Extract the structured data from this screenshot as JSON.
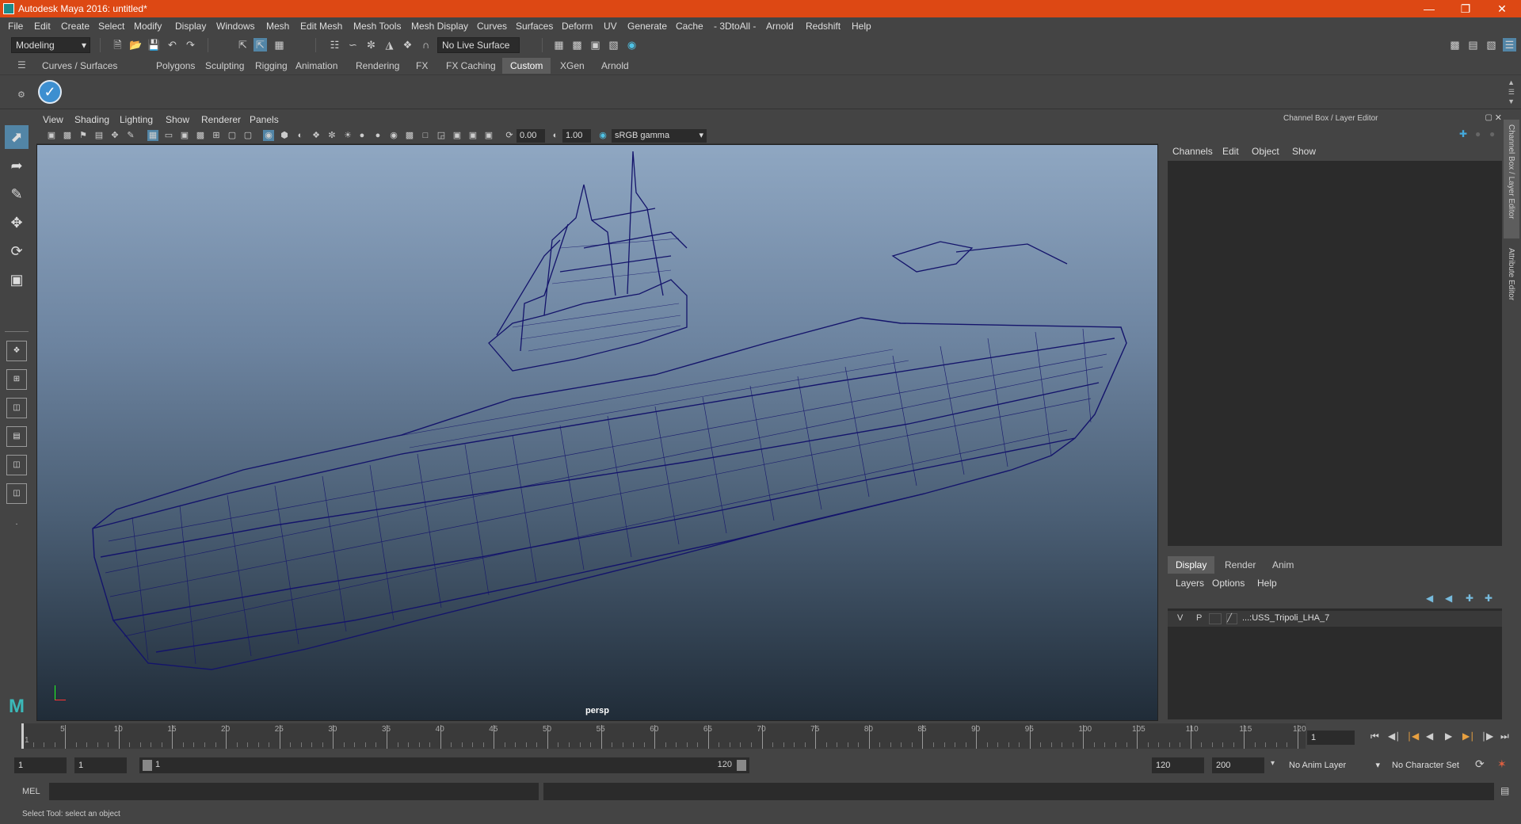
{
  "window": {
    "title": "Autodesk Maya 2016: untitled*",
    "minimize_icon": "minimize-icon",
    "restore_icon": "restore-icon",
    "close_icon": "close-icon"
  },
  "menubar": [
    "File",
    "Edit",
    "Create",
    "Select",
    "Modify",
    "Display",
    "Windows",
    "Mesh",
    "Edit Mesh",
    "Mesh Tools",
    "Mesh Display",
    "Curves",
    "Surfaces",
    "Deform",
    "UV",
    "Generate",
    "Cache",
    "- 3DtoAll -",
    "Arnold",
    "Redshift",
    "Help"
  ],
  "toolbar": {
    "mode": "Modeling",
    "live_surface": "No Live Surface"
  },
  "shelf_tabs": [
    "Curves / Surfaces",
    "Polygons",
    "Sculpting",
    "Rigging",
    "Animation",
    "Rendering",
    "FX",
    "FX Caching",
    "Custom",
    "XGen",
    "Arnold"
  ],
  "shelf_active": "Custom",
  "viewport": {
    "menu": [
      "View",
      "Shading",
      "Lighting",
      "Show",
      "Renderer",
      "Panels"
    ],
    "exposure": "0.00",
    "gamma": "1.00",
    "color_space": "sRGB gamma",
    "camera_label": "persp"
  },
  "channel_box": {
    "header": "Channel Box / Layer Editor",
    "menu": [
      "Channels",
      "Edit",
      "Object",
      "Show"
    ]
  },
  "layer_editor": {
    "tabs": [
      "Display",
      "Render",
      "Anim"
    ],
    "active_tab": "Display",
    "menu": [
      "Layers",
      "Options",
      "Help"
    ],
    "layers": [
      {
        "v": "V",
        "p": "P",
        "name": "...:USS_Tripoli_LHA_7"
      }
    ]
  },
  "side_tabs": [
    "Channel Box / Layer Editor",
    "Attribute Editor"
  ],
  "timeline": {
    "ticks": [
      "1",
      "5",
      "10",
      "15",
      "20",
      "25",
      "30",
      "35",
      "40",
      "45",
      "50",
      "55",
      "60",
      "65",
      "70",
      "75",
      "80",
      "85",
      "90",
      "95",
      "100",
      "105",
      "110",
      "115",
      "120"
    ],
    "current_frame": "1"
  },
  "range": {
    "start": "1",
    "playback_start": "1",
    "slider_start": "1",
    "slider_end": "120",
    "playback_end": "120",
    "end": "200",
    "anim_layer": "No Anim Layer",
    "character_set": "No Character Set"
  },
  "command_line": {
    "label": "MEL"
  },
  "help_line": "Select Tool: select an object"
}
